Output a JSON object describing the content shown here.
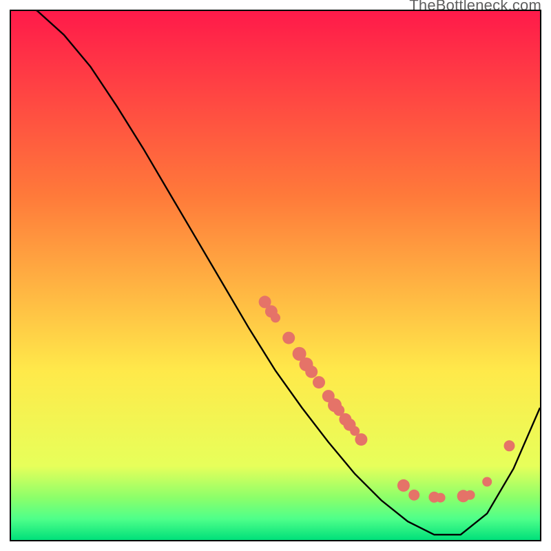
{
  "attribution": "TheBottleneck.com",
  "colors": {
    "gradient_red": "#ff1a4a",
    "gradient_orange": "#ff7a3a",
    "gradient_yellow": "#ffe94a",
    "gradient_yellowgreen": "#e7ff5a",
    "gradient_green_top": "#8cff6a",
    "gradient_green_mid": "#4fff8a",
    "gradient_green": "#00e07a",
    "curve": "#000000",
    "dot_fill": "#e57368",
    "dot_stroke": "#c25a50"
  },
  "chart_data": {
    "type": "line",
    "title": "",
    "xlabel": "",
    "ylabel": "",
    "xlim": [
      0,
      1
    ],
    "ylim": [
      0,
      1
    ],
    "legend": false,
    "grid": false,
    "series": [
      {
        "name": "curve",
        "x": [
          0.0,
          0.05,
          0.1,
          0.15,
          0.2,
          0.25,
          0.3,
          0.35,
          0.4,
          0.45,
          0.5,
          0.55,
          0.6,
          0.65,
          0.7,
          0.75,
          0.8,
          0.85,
          0.9,
          0.95,
          1.0
        ],
        "y": [
          1.03,
          1.0,
          0.955,
          0.895,
          0.82,
          0.74,
          0.655,
          0.57,
          0.485,
          0.4,
          0.32,
          0.25,
          0.185,
          0.125,
          0.075,
          0.035,
          0.01,
          0.01,
          0.05,
          0.135,
          0.25
        ]
      }
    ],
    "scatter_points": [
      {
        "x": 0.48,
        "y": 0.45,
        "r": 9
      },
      {
        "x": 0.492,
        "y": 0.432,
        "r": 9
      },
      {
        "x": 0.5,
        "y": 0.42,
        "r": 7
      },
      {
        "x": 0.525,
        "y": 0.382,
        "r": 9
      },
      {
        "x": 0.545,
        "y": 0.352,
        "r": 10
      },
      {
        "x": 0.558,
        "y": 0.332,
        "r": 10
      },
      {
        "x": 0.568,
        "y": 0.318,
        "r": 9
      },
      {
        "x": 0.582,
        "y": 0.298,
        "r": 9
      },
      {
        "x": 0.6,
        "y": 0.272,
        "r": 9
      },
      {
        "x": 0.612,
        "y": 0.255,
        "r": 10
      },
      {
        "x": 0.62,
        "y": 0.245,
        "r": 8
      },
      {
        "x": 0.632,
        "y": 0.228,
        "r": 9
      },
      {
        "x": 0.64,
        "y": 0.218,
        "r": 9
      },
      {
        "x": 0.65,
        "y": 0.206,
        "r": 7
      },
      {
        "x": 0.662,
        "y": 0.19,
        "r": 9
      },
      {
        "x": 0.742,
        "y": 0.103,
        "r": 9
      },
      {
        "x": 0.762,
        "y": 0.085,
        "r": 8
      },
      {
        "x": 0.8,
        "y": 0.081,
        "r": 8
      },
      {
        "x": 0.812,
        "y": 0.08,
        "r": 7
      },
      {
        "x": 0.855,
        "y": 0.083,
        "r": 9
      },
      {
        "x": 0.868,
        "y": 0.085,
        "r": 7
      },
      {
        "x": 0.9,
        "y": 0.11,
        "r": 7
      },
      {
        "x": 0.942,
        "y": 0.178,
        "r": 8
      }
    ]
  }
}
